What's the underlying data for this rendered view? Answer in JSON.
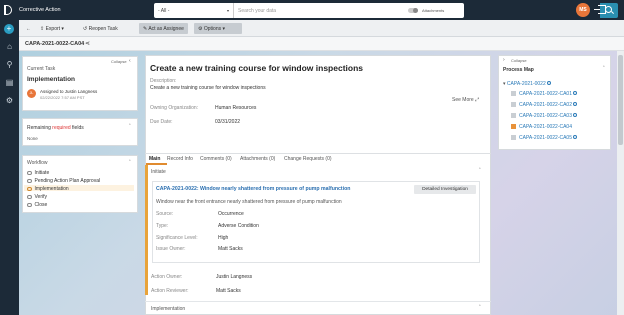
{
  "app": {
    "title": "Corrective Action"
  },
  "search": {
    "scope": "- All -",
    "placeholder": "Search your data",
    "attachments_label": "Attachments"
  },
  "user": {
    "initials": "MS"
  },
  "toolbar": {
    "export": "Export",
    "reopen": "Reopen Task",
    "assignee": "Act as Assignee",
    "options": "Options"
  },
  "breadcrumb": {
    "id": "CAPA-2021-0022-CA04"
  },
  "current_task": {
    "header": "Current Task",
    "collapse": "Collapse",
    "name": "Implementation",
    "assigned": "Assigned to Justin Langness",
    "date": "02/22/2022 7:57 AM PST",
    "avatar": "JL"
  },
  "remaining": {
    "prefix": "Remaining",
    "required": "required",
    "suffix": "fields",
    "value": "None"
  },
  "workflow": {
    "header": "Workflow",
    "steps": [
      "Initiate",
      "Pending Action Plan Approval",
      "Implementation",
      "Verify",
      "Close"
    ]
  },
  "main": {
    "title": "Create a new training course for window inspections",
    "description_label": "Description:",
    "description": "Create a new training course for window inspections",
    "see_more": "See More",
    "owning_org_label": "Owning Organization:",
    "owning_org": "Human Resources",
    "due_label": "Due Date:",
    "due": "03/31/2022",
    "tabs": [
      "Main",
      "Record Info",
      "Comments (0)",
      "Attachments (0)",
      "Change Requests (0)"
    ],
    "initiate": "Initiate",
    "link_title": "CAPA-2021-0022: Window nearly shattered from pressure of pump malfunction",
    "badge": "Detailed Investigation",
    "link_desc": "Window near the front entrance nearly shattered from pressure of pump malfunction",
    "source_label": "Source:",
    "source": "Occurrence",
    "type_label": "Type:",
    "type": "Adverse Condition",
    "sig_label": "Significance Level:",
    "sig": "High",
    "issue_label": "Issue Owner:",
    "issue": "Matt Sacks",
    "action_owner_label": "Action Owner:",
    "action_owner": "Justin Langness",
    "action_reviewer_label": "Action Reviewer:",
    "action_reviewer": "Matt Sacks",
    "implementation": "Implementation"
  },
  "process_map": {
    "collapse": "Collapse",
    "header": "Process Map",
    "root": "CAPA-2021-0022",
    "items": [
      "CAPA-2021-0022-CA01",
      "CAPA-2021-0022-CA02",
      "CAPA-2021-0022-CA03",
      "CAPA-2021-0022-CA04",
      "CAPA-2021-0022-CA05"
    ]
  }
}
